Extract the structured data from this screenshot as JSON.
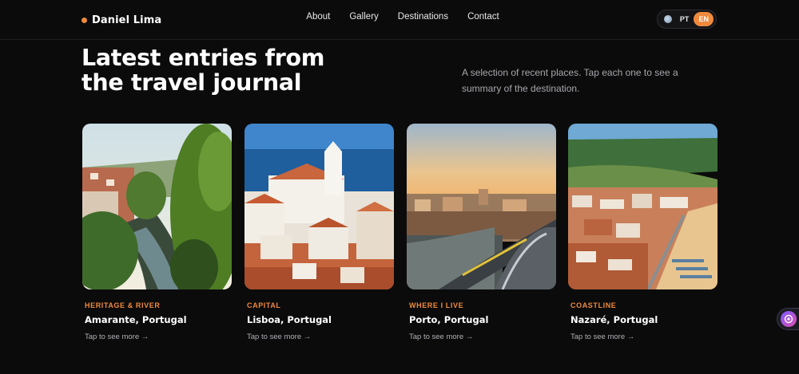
{
  "brand": {
    "name": "Daniel Lima",
    "accent": "#f08a3c"
  },
  "nav": {
    "links": [
      "About",
      "Gallery",
      "Destinations",
      "Contact"
    ]
  },
  "language": {
    "icon": "globe-icon",
    "options": [
      "PT",
      "EN"
    ],
    "selected": "EN"
  },
  "hero": {
    "title": "Latest entries from the travel journal",
    "intro": "A selection of recent places. Tap each one to see a summary of the destination."
  },
  "cards": [
    {
      "tag": "HERITAGE & RIVER",
      "place": "Amarante, Portugal",
      "cta": "Tap to see more →",
      "image": "river-town-photo"
    },
    {
      "tag": "CAPITAL",
      "place": "Lisboa, Portugal",
      "cta": "Tap to see more →",
      "image": "church-rooftops-photo"
    },
    {
      "tag": "WHERE I LIVE",
      "place": "Porto, Portugal",
      "cta": "Tap to see more →",
      "image": "bridge-sunset-photo"
    },
    {
      "tag": "COASTLINE",
      "place": "Nazaré, Portugal",
      "cta": "Tap to see more →",
      "image": "beach-town-photo"
    }
  ],
  "assistant": {
    "icon": "assistant-icon"
  }
}
